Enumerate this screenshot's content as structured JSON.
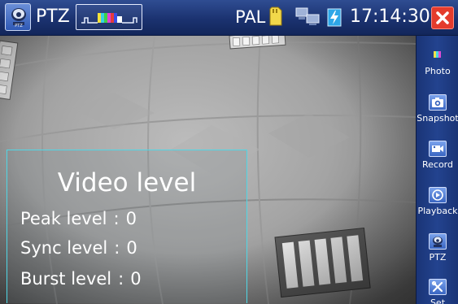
{
  "topbar": {
    "title": "PTZ",
    "video_standard": "PAL",
    "time": "17:14:30",
    "icons": [
      "ptz-camera-icon",
      "signal-waveform-icon",
      "sd-card-icon",
      "network-icon",
      "battery-charging-icon",
      "close-icon"
    ],
    "close_color": "#e43b2c"
  },
  "overlay": {
    "title": "Video level",
    "peak": {
      "label": "Peak level",
      "sep": ":",
      "value": "0"
    },
    "sync": {
      "label": "Sync level",
      "sep": ":",
      "value": "0"
    },
    "burst": {
      "label": "Burst level",
      "sep": ":",
      "value": "0"
    },
    "border_color": "#4fd7e6"
  },
  "sidebar": {
    "items": [
      {
        "label": "Photo",
        "icon": "photo-icon"
      },
      {
        "label": "Snapshot",
        "icon": "camera-icon"
      },
      {
        "label": "Record",
        "icon": "video-record-icon"
      },
      {
        "label": "Playback",
        "icon": "playback-icon"
      },
      {
        "label": "PTZ",
        "icon": "ptz-camera-icon"
      },
      {
        "label": "Set",
        "icon": "settings-tools-icon"
      }
    ]
  },
  "colors": {
    "bar_blue": "#1b3270",
    "accent_cyan": "#4fd7e6"
  }
}
